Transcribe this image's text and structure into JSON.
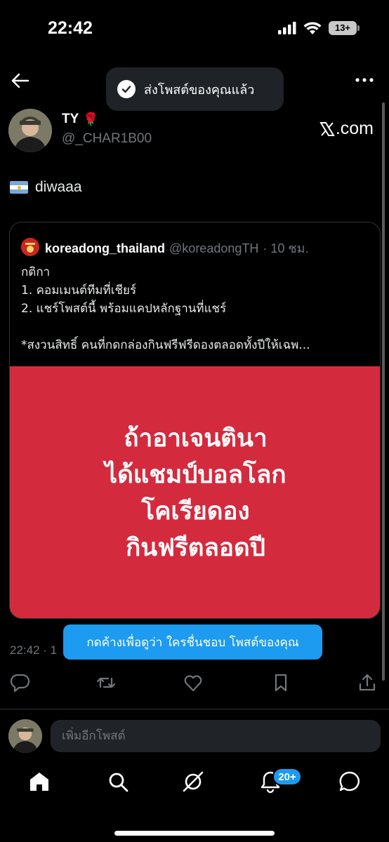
{
  "status_bar": {
    "time": "22:42",
    "battery": "13+"
  },
  "toast": {
    "message": "ส่งโพสต์ของคุณแล้ว"
  },
  "post": {
    "author_name": "TY",
    "author_emoji": "🌹",
    "author_handle": "@_CHAR1B00",
    "brand": "X.com",
    "text": "diwaaa",
    "timestamp": "22:42 · 1"
  },
  "quote": {
    "author_name": "koreadong_thailand",
    "author_handle": "@koreadongTH",
    "age": "· 10 ชม.",
    "lines": [
      "กติกา",
      "1. คอมเมนต์ทีมที่เชียร์",
      "2. แชร์โพสต์นี้ พร้อมแคปหลักฐานที่แชร์",
      "",
      "*สงวนสิทธิ์ คนที่กดกล่องกินฟรีฟรีดองตลอดทั้งปีให้เฉพ..."
    ],
    "image_lines": [
      "ถ้าอาเจนตินา",
      "ได้แชมป์บอลโลก",
      "โคเรียดอง",
      "กินฟรีตลอดปี"
    ],
    "image_color": "#d42a3e"
  },
  "tooltip": {
    "text": "กดค้างเพื่อดูว่า ใครชื่นชอบ โพสต์ของคุณ"
  },
  "actions": {
    "icons": [
      "reply-icon",
      "repost-icon",
      "like-icon",
      "bookmark-icon",
      "share-icon"
    ]
  },
  "reply": {
    "placeholder": "เพิ่มอีกโพสต์"
  },
  "tabbar": {
    "icons": [
      "home-icon",
      "search-icon",
      "grok-icon",
      "notifications-icon",
      "messages-icon"
    ],
    "notification_badge": "20+"
  },
  "colors": {
    "accent": "#1d9bf0",
    "background": "#000000",
    "secondary_text": "#71767b"
  }
}
